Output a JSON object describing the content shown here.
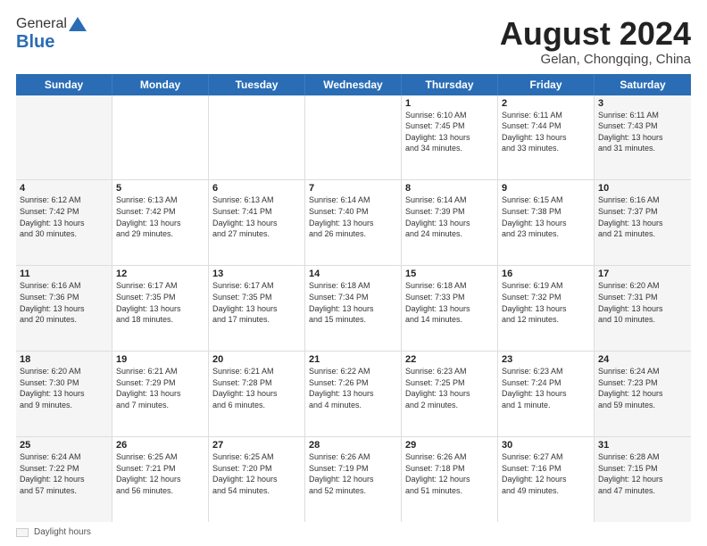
{
  "header": {
    "logo_general": "General",
    "logo_blue": "Blue",
    "month_year": "August 2024",
    "location": "Gelan, Chongqing, China"
  },
  "footer": {
    "label": "Daylight hours"
  },
  "days_of_week": [
    "Sunday",
    "Monday",
    "Tuesday",
    "Wednesday",
    "Thursday",
    "Friday",
    "Saturday"
  ],
  "weeks": [
    [
      {
        "day": "",
        "info": ""
      },
      {
        "day": "",
        "info": ""
      },
      {
        "day": "",
        "info": ""
      },
      {
        "day": "",
        "info": ""
      },
      {
        "day": "1",
        "info": "Sunrise: 6:10 AM\nSunset: 7:45 PM\nDaylight: 13 hours\nand 34 minutes."
      },
      {
        "day": "2",
        "info": "Sunrise: 6:11 AM\nSunset: 7:44 PM\nDaylight: 13 hours\nand 33 minutes."
      },
      {
        "day": "3",
        "info": "Sunrise: 6:11 AM\nSunset: 7:43 PM\nDaylight: 13 hours\nand 31 minutes."
      }
    ],
    [
      {
        "day": "4",
        "info": "Sunrise: 6:12 AM\nSunset: 7:42 PM\nDaylight: 13 hours\nand 30 minutes."
      },
      {
        "day": "5",
        "info": "Sunrise: 6:13 AM\nSunset: 7:42 PM\nDaylight: 13 hours\nand 29 minutes."
      },
      {
        "day": "6",
        "info": "Sunrise: 6:13 AM\nSunset: 7:41 PM\nDaylight: 13 hours\nand 27 minutes."
      },
      {
        "day": "7",
        "info": "Sunrise: 6:14 AM\nSunset: 7:40 PM\nDaylight: 13 hours\nand 26 minutes."
      },
      {
        "day": "8",
        "info": "Sunrise: 6:14 AM\nSunset: 7:39 PM\nDaylight: 13 hours\nand 24 minutes."
      },
      {
        "day": "9",
        "info": "Sunrise: 6:15 AM\nSunset: 7:38 PM\nDaylight: 13 hours\nand 23 minutes."
      },
      {
        "day": "10",
        "info": "Sunrise: 6:16 AM\nSunset: 7:37 PM\nDaylight: 13 hours\nand 21 minutes."
      }
    ],
    [
      {
        "day": "11",
        "info": "Sunrise: 6:16 AM\nSunset: 7:36 PM\nDaylight: 13 hours\nand 20 minutes."
      },
      {
        "day": "12",
        "info": "Sunrise: 6:17 AM\nSunset: 7:35 PM\nDaylight: 13 hours\nand 18 minutes."
      },
      {
        "day": "13",
        "info": "Sunrise: 6:17 AM\nSunset: 7:35 PM\nDaylight: 13 hours\nand 17 minutes."
      },
      {
        "day": "14",
        "info": "Sunrise: 6:18 AM\nSunset: 7:34 PM\nDaylight: 13 hours\nand 15 minutes."
      },
      {
        "day": "15",
        "info": "Sunrise: 6:18 AM\nSunset: 7:33 PM\nDaylight: 13 hours\nand 14 minutes."
      },
      {
        "day": "16",
        "info": "Sunrise: 6:19 AM\nSunset: 7:32 PM\nDaylight: 13 hours\nand 12 minutes."
      },
      {
        "day": "17",
        "info": "Sunrise: 6:20 AM\nSunset: 7:31 PM\nDaylight: 13 hours\nand 10 minutes."
      }
    ],
    [
      {
        "day": "18",
        "info": "Sunrise: 6:20 AM\nSunset: 7:30 PM\nDaylight: 13 hours\nand 9 minutes."
      },
      {
        "day": "19",
        "info": "Sunrise: 6:21 AM\nSunset: 7:29 PM\nDaylight: 13 hours\nand 7 minutes."
      },
      {
        "day": "20",
        "info": "Sunrise: 6:21 AM\nSunset: 7:28 PM\nDaylight: 13 hours\nand 6 minutes."
      },
      {
        "day": "21",
        "info": "Sunrise: 6:22 AM\nSunset: 7:26 PM\nDaylight: 13 hours\nand 4 minutes."
      },
      {
        "day": "22",
        "info": "Sunrise: 6:23 AM\nSunset: 7:25 PM\nDaylight: 13 hours\nand 2 minutes."
      },
      {
        "day": "23",
        "info": "Sunrise: 6:23 AM\nSunset: 7:24 PM\nDaylight: 13 hours\nand 1 minute."
      },
      {
        "day": "24",
        "info": "Sunrise: 6:24 AM\nSunset: 7:23 PM\nDaylight: 12 hours\nand 59 minutes."
      }
    ],
    [
      {
        "day": "25",
        "info": "Sunrise: 6:24 AM\nSunset: 7:22 PM\nDaylight: 12 hours\nand 57 minutes."
      },
      {
        "day": "26",
        "info": "Sunrise: 6:25 AM\nSunset: 7:21 PM\nDaylight: 12 hours\nand 56 minutes."
      },
      {
        "day": "27",
        "info": "Sunrise: 6:25 AM\nSunset: 7:20 PM\nDaylight: 12 hours\nand 54 minutes."
      },
      {
        "day": "28",
        "info": "Sunrise: 6:26 AM\nSunset: 7:19 PM\nDaylight: 12 hours\nand 52 minutes."
      },
      {
        "day": "29",
        "info": "Sunrise: 6:26 AM\nSunset: 7:18 PM\nDaylight: 12 hours\nand 51 minutes."
      },
      {
        "day": "30",
        "info": "Sunrise: 6:27 AM\nSunset: 7:16 PM\nDaylight: 12 hours\nand 49 minutes."
      },
      {
        "day": "31",
        "info": "Sunrise: 6:28 AM\nSunset: 7:15 PM\nDaylight: 12 hours\nand 47 minutes."
      }
    ]
  ]
}
